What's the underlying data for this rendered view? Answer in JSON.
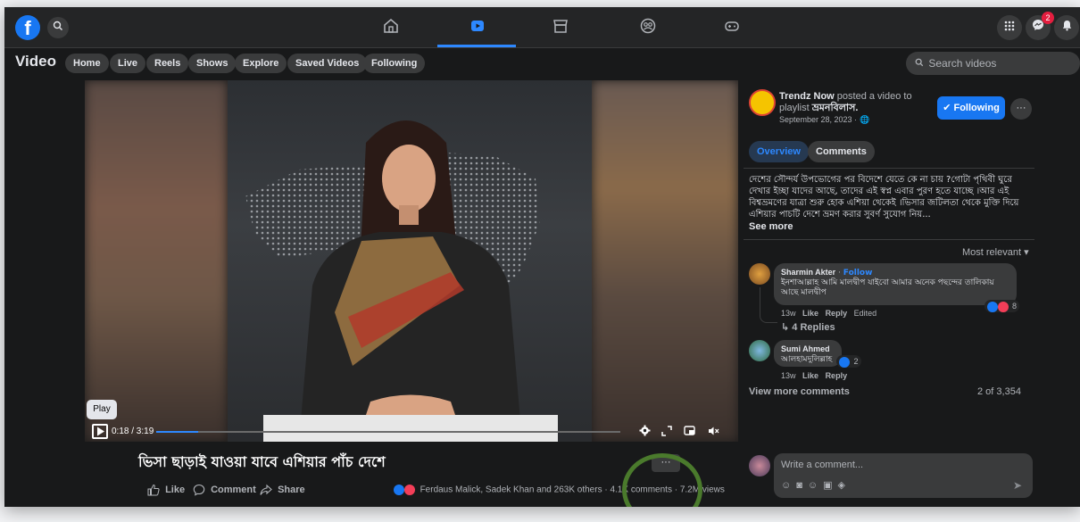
{
  "topbar": {
    "search_icon": "search-icon",
    "messenger_badge": "2",
    "nav": [
      "home-icon",
      "video-icon",
      "marketplace-icon",
      "groups-icon",
      "gaming-icon"
    ]
  },
  "subnav": {
    "title": "Video",
    "pills": [
      "Home",
      "Live",
      "Reels",
      "Shows",
      "Explore",
      "Saved Videos",
      "Following"
    ],
    "search_placeholder": "Search videos"
  },
  "player": {
    "tooltip": "Play",
    "time": "0:18 / 3:19",
    "progress": 0.09
  },
  "video": {
    "caption": "ভিসা ছাড়াই যাওয়া যাবে এশিয়ার পাঁচ দেশে",
    "more": "···",
    "actions": {
      "like": "Like",
      "comment": "Comment",
      "share": "Share"
    },
    "reactions": "Ferdaus Malick, Sadek Khan and 263K others",
    "comments": "4.1K comments",
    "views": "7.2M views"
  },
  "panel": {
    "page_name": "Trendz Now",
    "posted": "posted a video to playlist",
    "playlist": "ভ্রমনবিলাস",
    "date": "September 28, 2023 ·",
    "follow": "Following",
    "more": "···",
    "tabs": [
      "Overview",
      "Comments"
    ],
    "description": "দেশের সৌন্দর্য উপভোগের পর বিদেশে যেতে কে না চায় ?গোটা পৃথিবী ঘুরে দেখার ইচ্ছা যাদের আছে, তাদের এই স্বপ্ন এবার পুরণ হতে যাচ্ছে ।আর এই বিশ্বভ্রমণের যাত্রা শুরু হোক এশিয়া থেকেই ।ভিসার জটিলতা থেকে মুক্তি দিয়ে এশিয়ার পাচটি দেশে ভ্রমণ করার সুবর্ণ সুযোগ নিয়...",
    "see_more": "See more",
    "sort": "Most relevant",
    "comments": [
      {
        "author": "Sharmin Akter",
        "follow": "Follow",
        "text": "ইনশাআল্লাহ আমি মালদ্বীপ যাইবো আমার অনেক পছন্দের তালিকায় আছে মালদ্বীপ",
        "time": "13w",
        "like": "Like",
        "reply": "Reply",
        "edited": "Edited",
        "reactions": "8",
        "replies": "4 Replies"
      },
      {
        "author": "Sumi Ahmed",
        "text": "আলহামদুলিল্লাহ",
        "time": "13w",
        "like": "Like",
        "reply": "Reply",
        "reactions": "2"
      }
    ],
    "view_more": "View more comments",
    "count": "2 of 3,354",
    "write_placeholder": "Write a comment..."
  },
  "colors": {
    "accent": "#1877f2",
    "annotation": "#4a7a2c"
  }
}
